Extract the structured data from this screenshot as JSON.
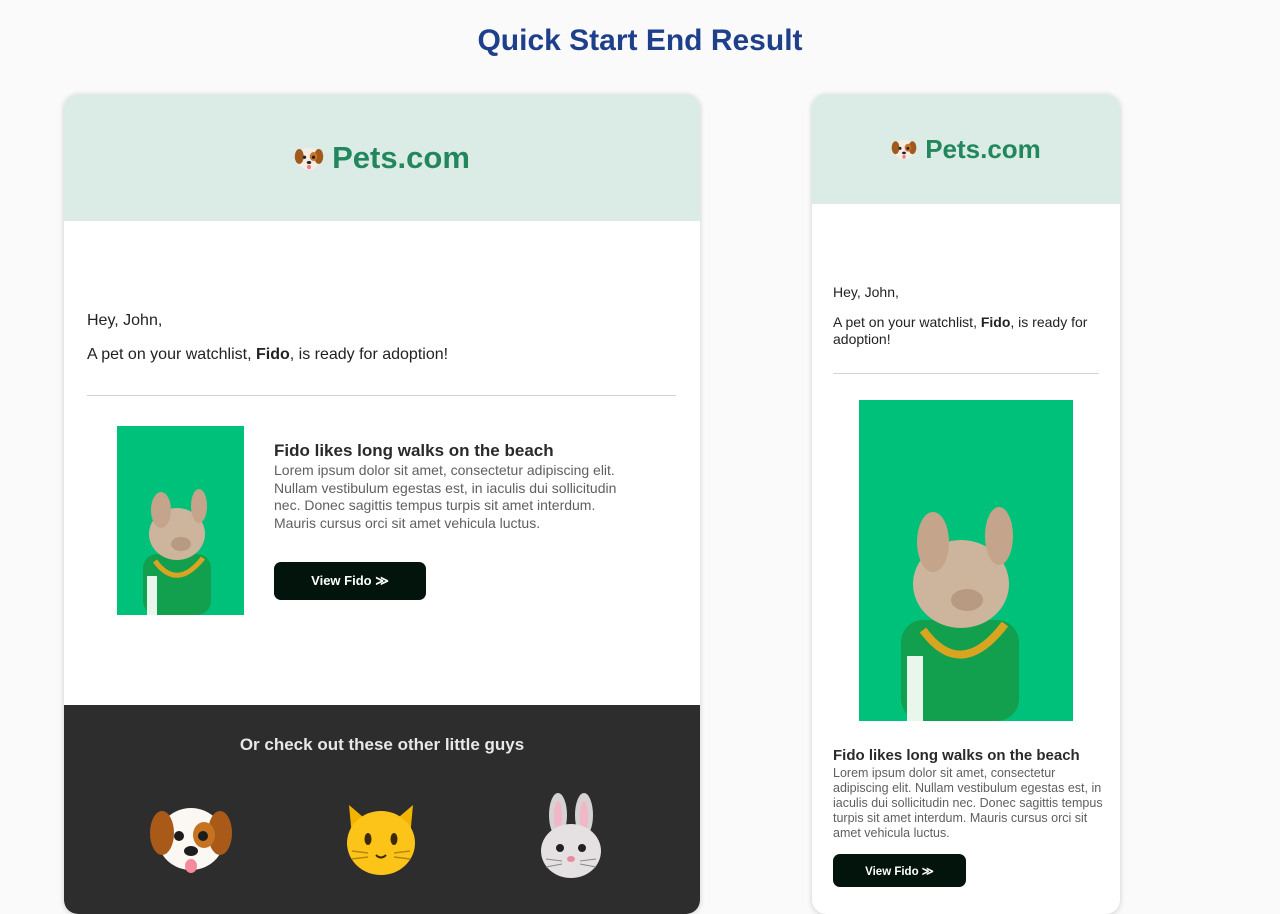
{
  "page_title": "Quick Start End Result",
  "brand": {
    "name": "Pets.com",
    "icon": "dog-face-icon"
  },
  "colors": {
    "title": "#1e3f8a",
    "header_bg": "#dbece6",
    "brand": "#23875e",
    "button_bg": "#03140d",
    "footer_bg": "#2d2d2d",
    "image_bg": "#00c17a"
  },
  "email": {
    "greeting": "Hey, John,",
    "message_before": "A pet on your watchlist, ",
    "pet_name": "Fido",
    "message_after": ", is ready for adoption!",
    "feature": {
      "heading": "Fido likes long walks on the beach",
      "description": "Lorem ipsum dolor sit amet, consectetur adipiscing elit. Nullam vestibulum egestas est, in iaculis dui sollicitudin nec. Donec sagittis tempus turpis sit amet interdum. Mauris cursus orci sit amet vehicula luctus.",
      "button_label": "View Fido ≫"
    },
    "footer": {
      "title": "Or check out these other little guys",
      "pets": [
        {
          "name": "dog-face-icon"
        },
        {
          "name": "cat-face-icon"
        },
        {
          "name": "rabbit-face-icon"
        }
      ]
    }
  }
}
